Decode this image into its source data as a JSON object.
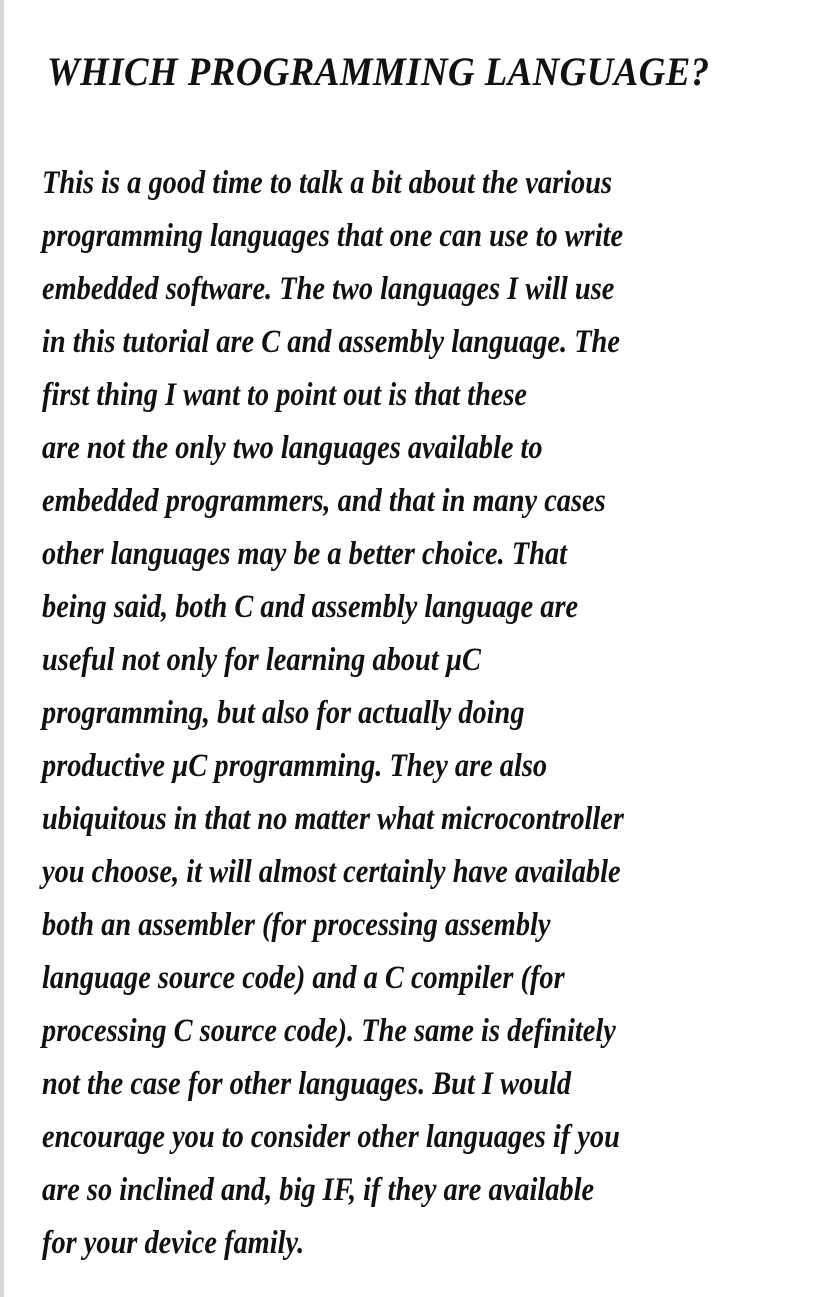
{
  "document": {
    "title": "WHICH PROGRAMMING LANGUAGE?",
    "paragraph_lines": [
      "This is a good time to talk a bit about the various",
      "programming languages that one can use to write",
      "embedded software.  The two languages I will use",
      "in this tutorial are C and assembly language.  The",
      "first thing I want to point out is that these",
      "are not the only two languages available to",
      "embedded programmers,  and that in many cases",
      "other languages may be a better choice.  That",
      "being said,  both C and assembly language are",
      "useful not only for learning about µC",
      "programming,  but also for actually doing",
      "productive µC programming.  They are also",
      "ubiquitous in that no matter what microcontroller",
      "you choose,  it will almost certainly have available",
      "both an assembler (for processing assembly",
      "language source code) and a C compiler (for",
      "processing C source code).  The same is definitely",
      "not the case for other languages.  But I would",
      "encourage you to consider other languages if you",
      "are so inclined and,  big IF,  if they are available",
      "for your device family."
    ]
  }
}
